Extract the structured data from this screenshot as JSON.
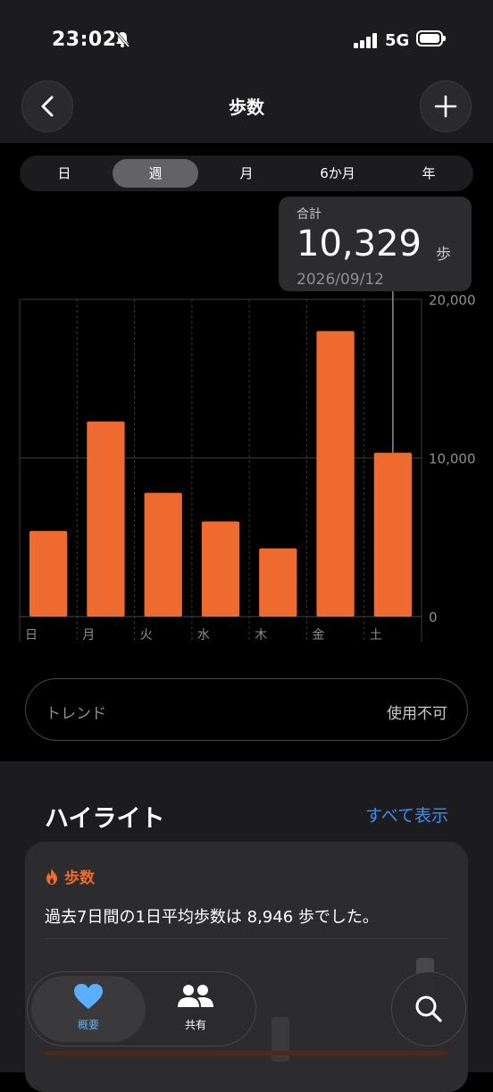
{
  "status": {
    "time": "23:02",
    "network": "5G"
  },
  "nav": {
    "title": "歩数"
  },
  "segments": [
    {
      "label": "日",
      "active": false
    },
    {
      "label": "週",
      "active": true
    },
    {
      "label": "月",
      "active": false
    },
    {
      "label": "6か月",
      "active": false
    },
    {
      "label": "年",
      "active": false
    }
  ],
  "tooltip": {
    "caption": "合計",
    "value": "10,329",
    "unit": "歩",
    "date": "2026/09/12"
  },
  "chart_data": {
    "type": "bar",
    "categories": [
      "日",
      "月",
      "火",
      "水",
      "木",
      "金",
      "土"
    ],
    "values": [
      5400,
      12300,
      7800,
      6000,
      4300,
      18000,
      10329
    ],
    "ylim": [
      0,
      20000
    ],
    "yticks": [
      "0",
      "10,000",
      "20,000"
    ],
    "bar_color": "#ef6a2e",
    "highlighted_index": 6
  },
  "trend": {
    "label": "トレンド",
    "value": "使用不可"
  },
  "highlights": {
    "title": "ハイライト",
    "show_all": "すべて表示",
    "card": {
      "category": "歩数",
      "text": "過去7日間の1日平均歩数は 8,946 歩でした。"
    }
  },
  "tabbar": {
    "items": [
      {
        "label": "概要",
        "active": true
      },
      {
        "label": "共有",
        "active": false
      }
    ]
  },
  "colors": {
    "accent": "#ef6a2e",
    "link": "#3a8ff5",
    "active_tab": "#5ab0ff"
  }
}
